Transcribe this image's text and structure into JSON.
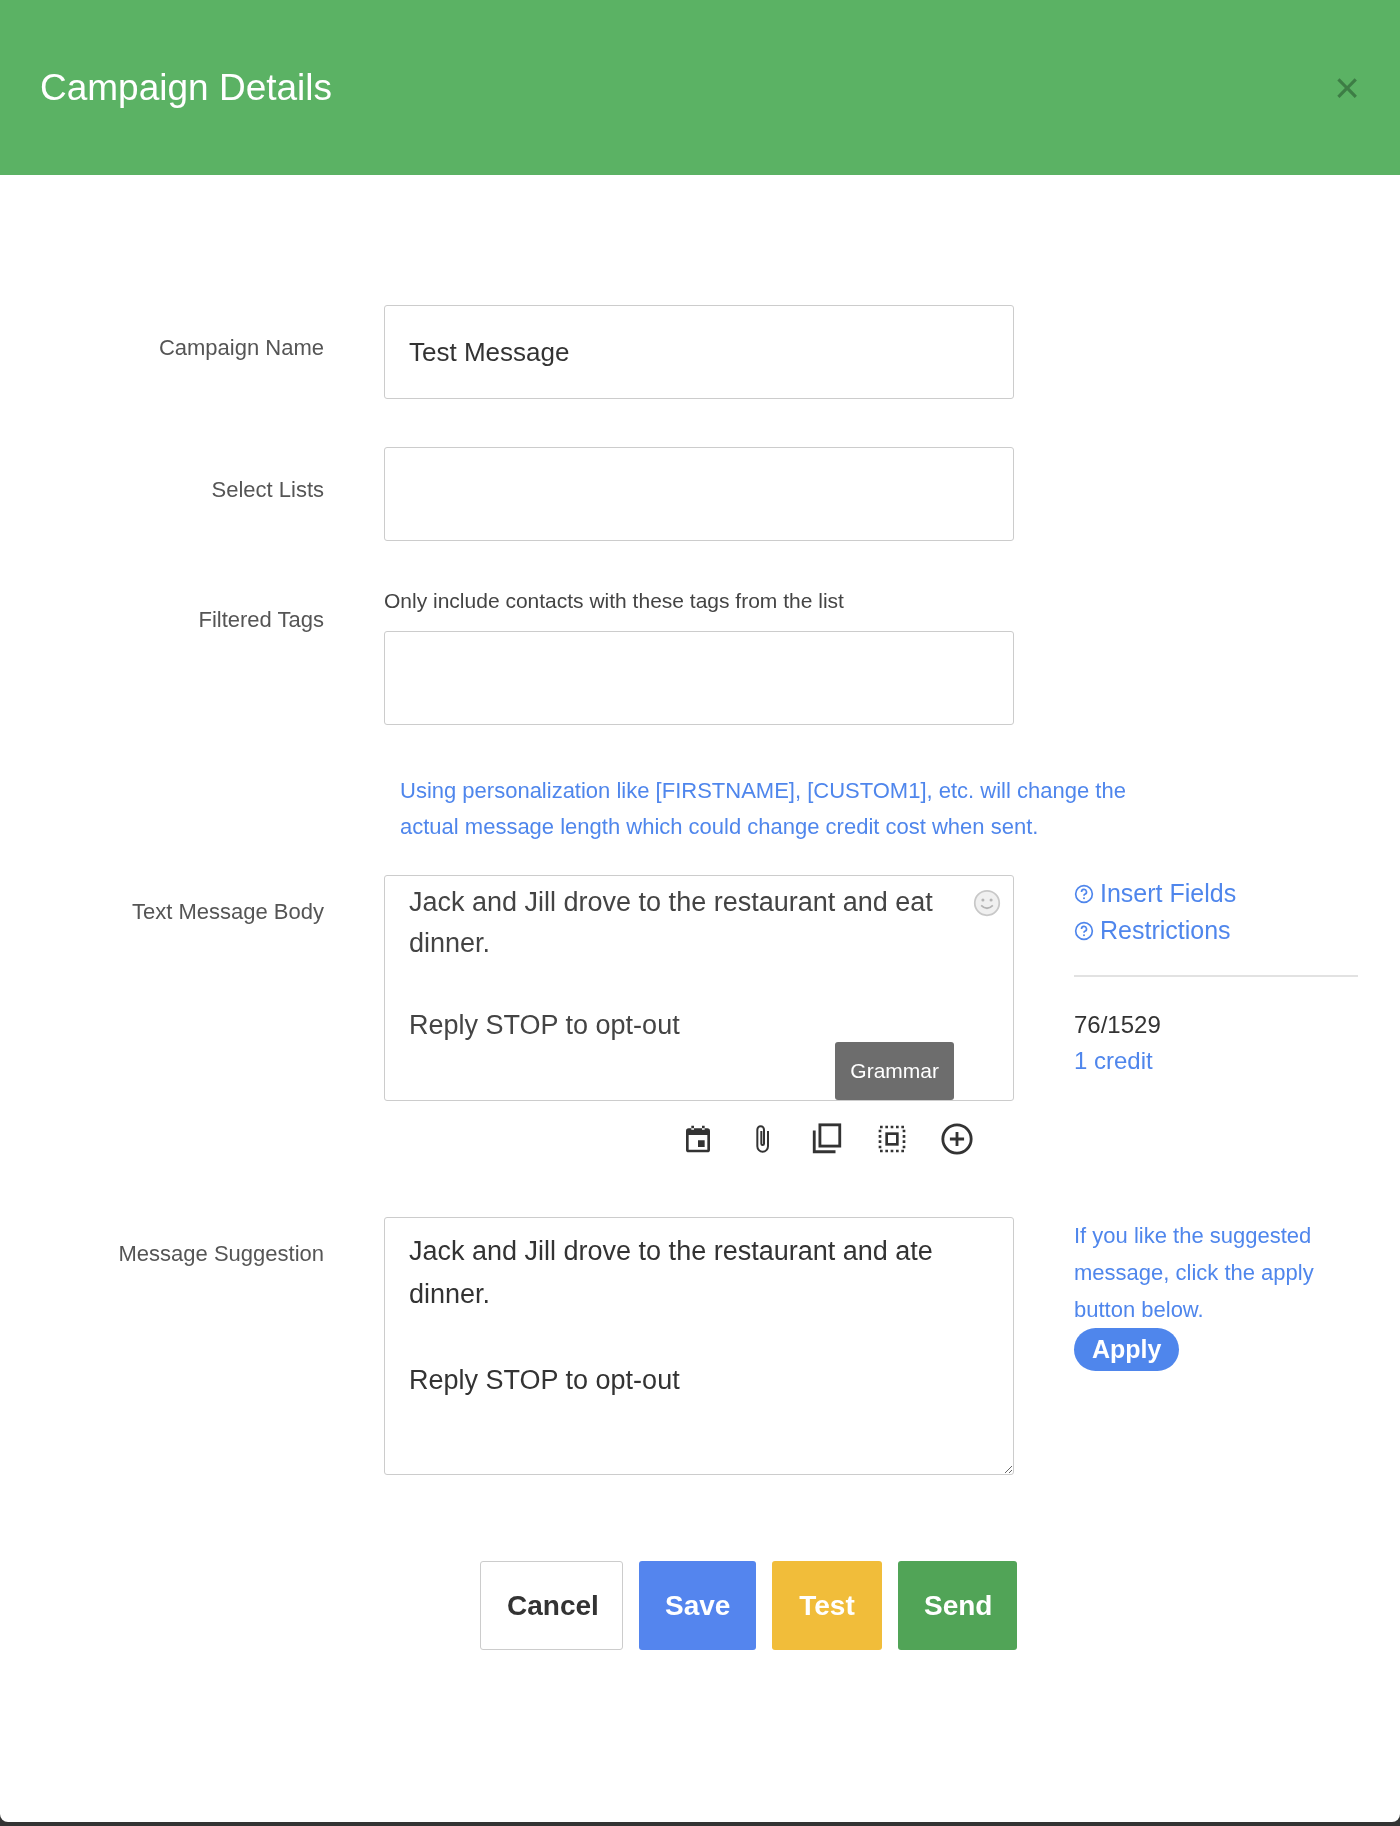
{
  "dialog": {
    "title": "Campaign Details",
    "close": "×"
  },
  "fields": [
    {
      "kind": "input",
      "label": "Campaign Name",
      "value": "Test Message"
    },
    {
      "kind": "input",
      "label": "Select Lists"
    },
    {
      "kind": "input",
      "label": "Filtered Tags",
      "helper": "Only include contacts with these tags from the list"
    }
  ],
  "personalization_note": "Using personalization like [FIRSTNAME], [CUSTOM1], etc. will change the actual message length which could change credit cost when sent.",
  "message_body": {
    "label": "Text Message Body",
    "value": "Jack and Jill drove to the restaurant and eat dinner.\n\nReply STOP to opt-out",
    "tooltip": "Grammar",
    "links": [
      "Insert Fields",
      "Restrictions"
    ],
    "count": "76/1529",
    "credits": "1 credit"
  },
  "suggestion": {
    "label": "Message Suggestion",
    "value": "Jack and Jill drove to the restaurant and ate dinner.\n\nReply STOP to opt-out",
    "hint": "If you like the suggested message, click the apply button below.",
    "apply": "Apply"
  },
  "buttons": [
    {
      "kind": "cancel",
      "label": "Cancel"
    },
    {
      "kind": "save",
      "label": "Save"
    },
    {
      "kind": "test",
      "label": "Test"
    },
    {
      "kind": "send",
      "label": "Send"
    }
  ]
}
